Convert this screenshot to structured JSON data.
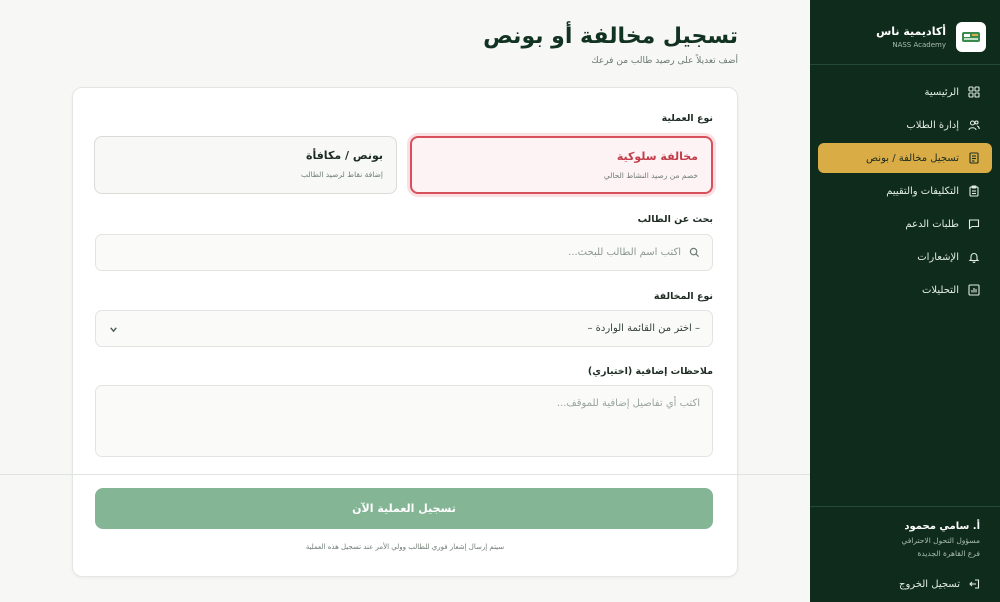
{
  "brand": {
    "name": "أكاديمية ناس",
    "subtitle": "NASS Academy"
  },
  "nav": {
    "items": [
      {
        "label": "الرئيسية",
        "icon": "grid-icon"
      },
      {
        "label": "إدارة الطلاب",
        "icon": "users-icon"
      },
      {
        "label": "تسجيل مخالفة / بونص",
        "icon": "record-icon",
        "active": true
      },
      {
        "label": "التكليفات والتقييم",
        "icon": "clipboard-icon"
      },
      {
        "label": "طلبات الدعم",
        "icon": "chat-icon"
      },
      {
        "label": "الإشعارات",
        "icon": "bell-icon"
      },
      {
        "label": "التحليلات",
        "icon": "chart-icon"
      }
    ]
  },
  "user": {
    "name": "أ. سامي محمود",
    "role": "مسؤول التحول الاحترافي",
    "branch": "فرع القاهرة الجديدة"
  },
  "logout_label": "تسجيل الخروج",
  "page": {
    "title": "تسجيل مخالفة أو بونص",
    "subtitle": "أضف تعديلاً على رصيد طالب من فرعك"
  },
  "form": {
    "operation_label": "نوع العملية",
    "violation": {
      "title": "مخالفة سلوكية",
      "desc": "خصم من رصيد النشاط الحالي"
    },
    "bonus": {
      "title": "بونص / مكافأة",
      "desc": "إضافة نقاط لرصيد الطالب"
    },
    "search_label": "بحث عن الطالب",
    "search_placeholder": "اكتب اسم الطالب للبحث...",
    "violation_type_label": "نوع المخالفة",
    "violation_type_value": "– اختر من القائمة الواردة –",
    "notes_label": "ملاحظات إضافية (اختياري)",
    "notes_placeholder": "اكتب أي تفاصيل إضافية للموقف...",
    "submit_label": "تسجيل العملية الآن",
    "footer_note": "سيتم إرسال إشعار فوري للطالب وولي الأمر عند تسجيل هذه العملية"
  },
  "colors": {
    "sidebar": "#0f2b1c",
    "active_nav": "#d9ac45",
    "violation": "#c23d4a",
    "submit": "#84b595"
  }
}
